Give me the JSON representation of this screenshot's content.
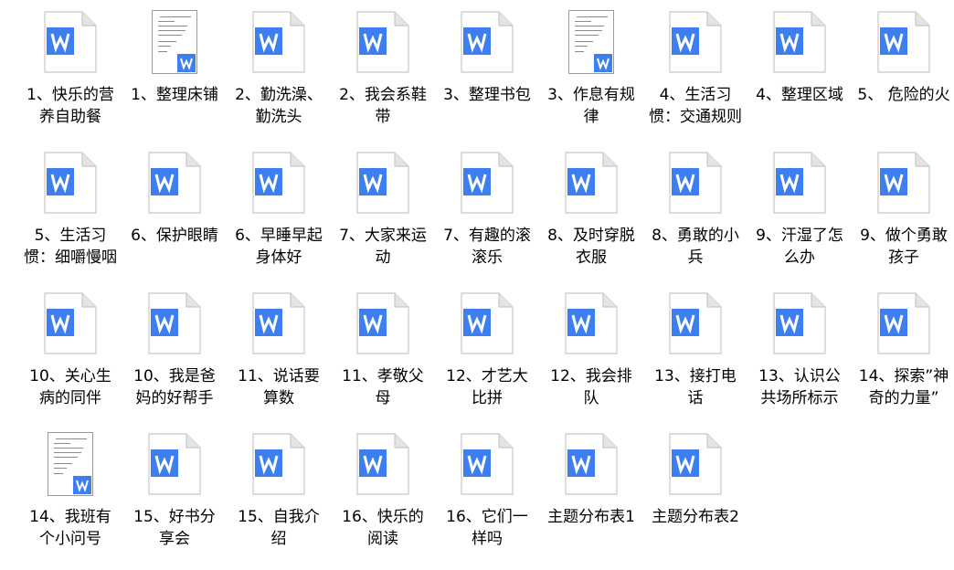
{
  "files": [
    {
      "name": "1、快乐的营养自助餐",
      "icon": "word-doc-icon"
    },
    {
      "name": "1、整理床铺",
      "icon": "doc-preview-thumbnail"
    },
    {
      "name": "2、勤洗澡、勤洗头",
      "icon": "word-doc-icon"
    },
    {
      "name": "2、我会系鞋带",
      "icon": "word-doc-icon"
    },
    {
      "name": "3、整理书包",
      "icon": "word-doc-icon"
    },
    {
      "name": "3、作息有规律",
      "icon": "doc-preview-thumbnail"
    },
    {
      "name": "4、生活习惯：交通规则",
      "icon": "word-doc-icon"
    },
    {
      "name": "4、整理区域",
      "icon": "word-doc-icon"
    },
    {
      "name": "5、 危险的火",
      "icon": "word-doc-icon"
    },
    {
      "name": "5、生活习惯：细嚼慢咽",
      "icon": "word-doc-icon"
    },
    {
      "name": "6、保护眼睛",
      "icon": "word-doc-icon"
    },
    {
      "name": "6、早睡早起身体好",
      "icon": "word-doc-icon"
    },
    {
      "name": "7、大家来运动",
      "icon": "word-doc-icon"
    },
    {
      "name": "7、有趣的滚滚乐",
      "icon": "word-doc-icon"
    },
    {
      "name": "8、及时穿脱衣服",
      "icon": "word-doc-icon"
    },
    {
      "name": "8、勇敢的小兵",
      "icon": "word-doc-icon"
    },
    {
      "name": "9、汗湿了怎么办",
      "icon": "word-doc-icon"
    },
    {
      "name": "9、做个勇敢孩子",
      "icon": "word-doc-icon"
    },
    {
      "name": "10、关心生病的同伴",
      "icon": "word-doc-icon"
    },
    {
      "name": "10、我是爸妈的好帮手",
      "icon": "word-doc-icon"
    },
    {
      "name": "11、说话要算数",
      "icon": "word-doc-icon"
    },
    {
      "name": "11、孝敬父母",
      "icon": "word-doc-icon"
    },
    {
      "name": "12、才艺大比拼",
      "icon": "word-doc-icon"
    },
    {
      "name": "12、我会排队",
      "icon": "word-doc-icon"
    },
    {
      "name": "13、接打电话",
      "icon": "word-doc-icon"
    },
    {
      "name": "13、认识公共场所标示",
      "icon": "word-doc-icon"
    },
    {
      "name": "14、探索”神奇的力量”",
      "icon": "word-doc-icon"
    },
    {
      "name": "14、我班有个小问号",
      "icon": "doc-preview-thumbnail"
    },
    {
      "name": "15、好书分享会",
      "icon": "word-doc-icon"
    },
    {
      "name": "15、自我介绍",
      "icon": "word-doc-icon"
    },
    {
      "name": "16、快乐的阅读",
      "icon": "word-doc-icon"
    },
    {
      "name": "16、它们一样吗",
      "icon": "word-doc-icon"
    },
    {
      "name": "主题分布表1",
      "icon": "word-doc-icon"
    },
    {
      "name": "主题分布表2",
      "icon": "word-doc-icon"
    }
  ],
  "colors": {
    "accent": "#3d7ef0",
    "page": "#ffffff",
    "page_border": "#c8c8c8",
    "fold": "#e4e4e4"
  }
}
